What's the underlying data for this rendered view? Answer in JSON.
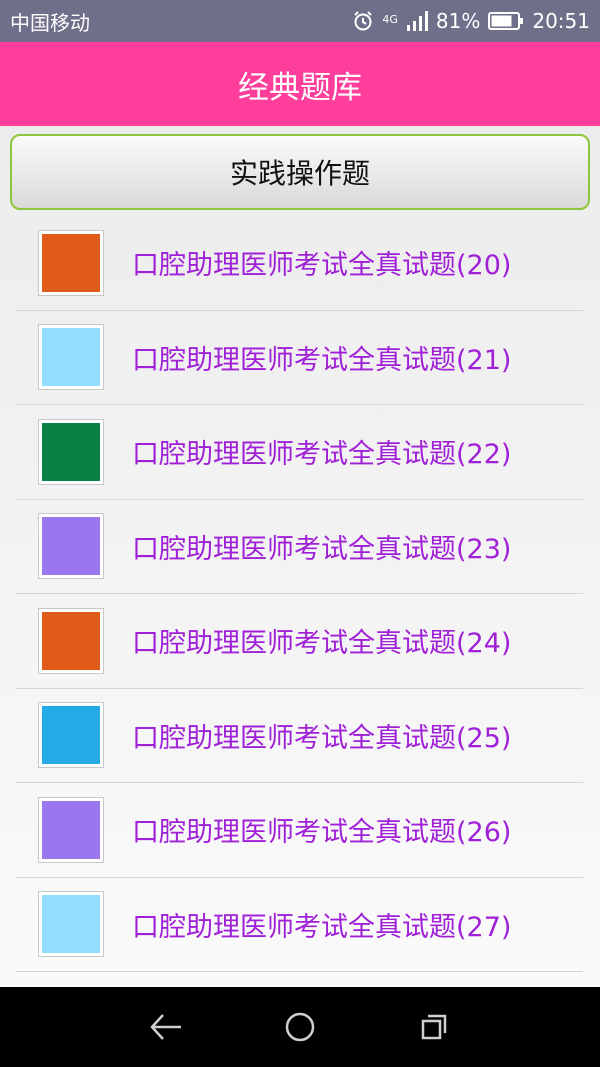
{
  "status_bar": {
    "carrier": "中国移动",
    "network": "4G",
    "battery": "81%",
    "time": "20:51",
    "icons": [
      "alarm-icon",
      "signal-icon",
      "battery-icon"
    ]
  },
  "header": {
    "title": "经典题库",
    "color": "#ff3d9a"
  },
  "practice_button": {
    "label": "实践操作题"
  },
  "list": {
    "items": [
      {
        "label": "口腔助理医师考试全真试题(20)",
        "color": "#e05a1a"
      },
      {
        "label": "口腔助理医师考试全真试题(21)",
        "color": "#93ddff"
      },
      {
        "label": "口腔助理医师考试全真试题(22)",
        "color": "#0a7f46"
      },
      {
        "label": "口腔助理医师考试全真试题(23)",
        "color": "#9b77ef"
      },
      {
        "label": "口腔助理医师考试全真试题(24)",
        "color": "#e05a1a"
      },
      {
        "label": "口腔助理医师考试全真试题(25)",
        "color": "#24aae4"
      },
      {
        "label": "口腔助理医师考试全真试题(26)",
        "color": "#9b77ef"
      },
      {
        "label": "口腔助理医师考试全真试题(27)",
        "color": "#93ddff"
      }
    ]
  },
  "nav_bar": {
    "icons": [
      "back-icon",
      "home-icon",
      "recents-icon"
    ]
  }
}
